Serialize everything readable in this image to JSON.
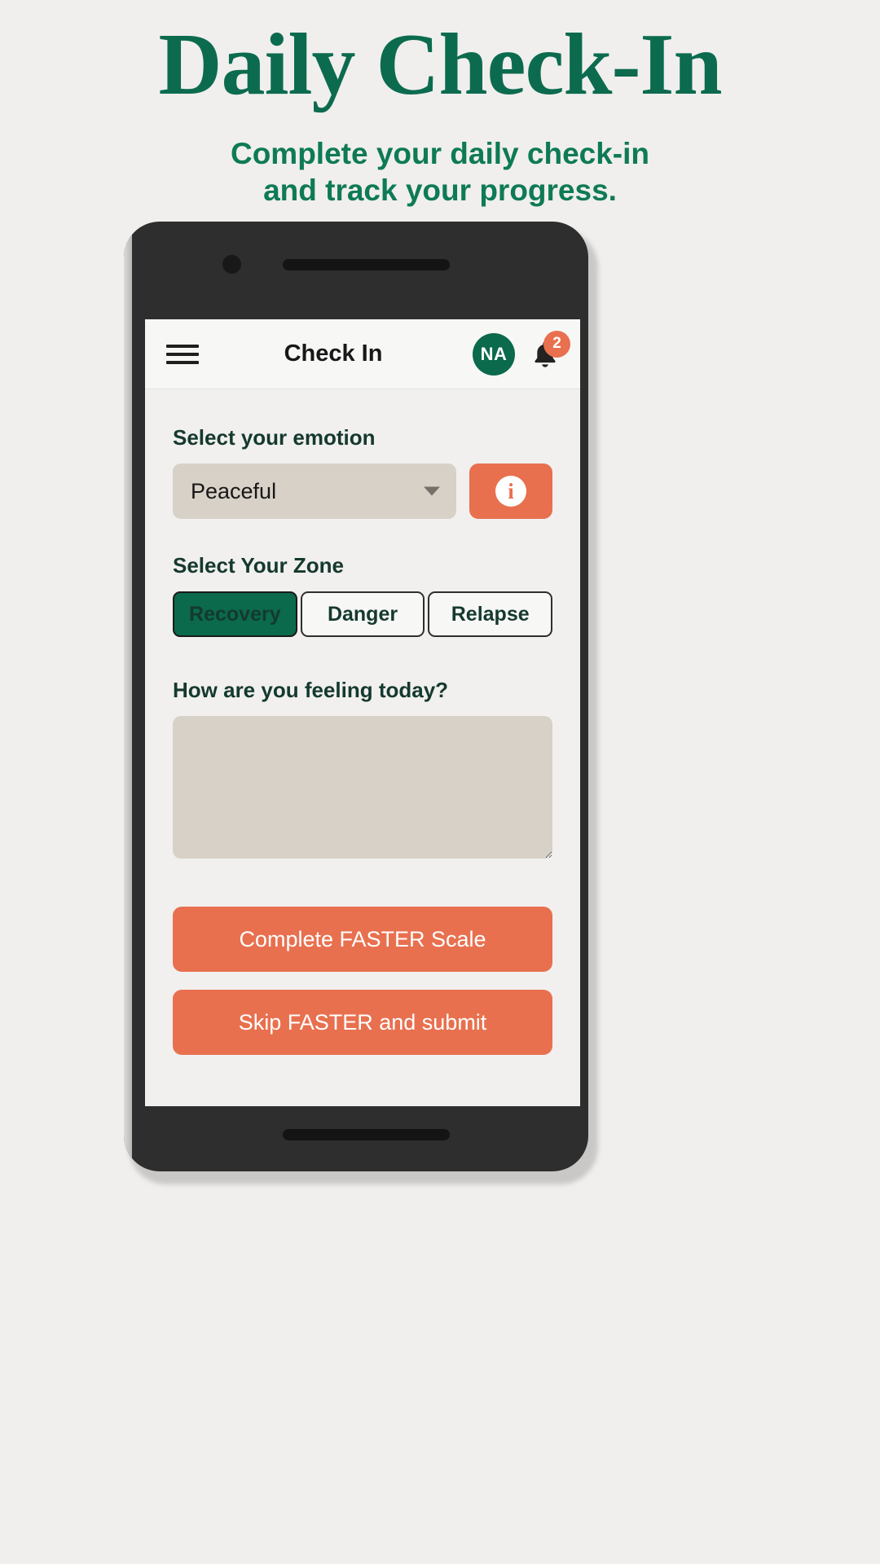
{
  "hero": {
    "title": "Daily Check-In",
    "subtitle_line1": "Complete your daily check-in",
    "subtitle_line2": "and track your progress."
  },
  "colors": {
    "brand_green": "#0a6a4b",
    "heading_green": "#0c6b4f",
    "dark_green_text": "#15392f",
    "accent_coral": "#e8704f",
    "field_taupe": "#d8d1c8",
    "page_bg": "#f0efed",
    "screen_bg": "#f1f0ee"
  },
  "appbar": {
    "menu_icon": "hamburger-menu-icon",
    "title": "Check In",
    "avatar_initials": "NA",
    "bell_icon": "notification-bell-icon",
    "notification_count": "2"
  },
  "emotion": {
    "label": "Select your emotion",
    "selected": "Peaceful",
    "caret_icon": "chevron-down-icon",
    "info_icon": "info-icon"
  },
  "zone": {
    "label": "Select Your Zone",
    "options": [
      {
        "label": "Recovery",
        "selected": true
      },
      {
        "label": "Danger",
        "selected": false
      },
      {
        "label": "Relapse",
        "selected": false
      }
    ]
  },
  "feelings": {
    "label": "How are you feeling today?",
    "value": "",
    "placeholder": ""
  },
  "actions": {
    "primary": "Complete FASTER Scale",
    "secondary": "Skip FASTER and submit"
  }
}
